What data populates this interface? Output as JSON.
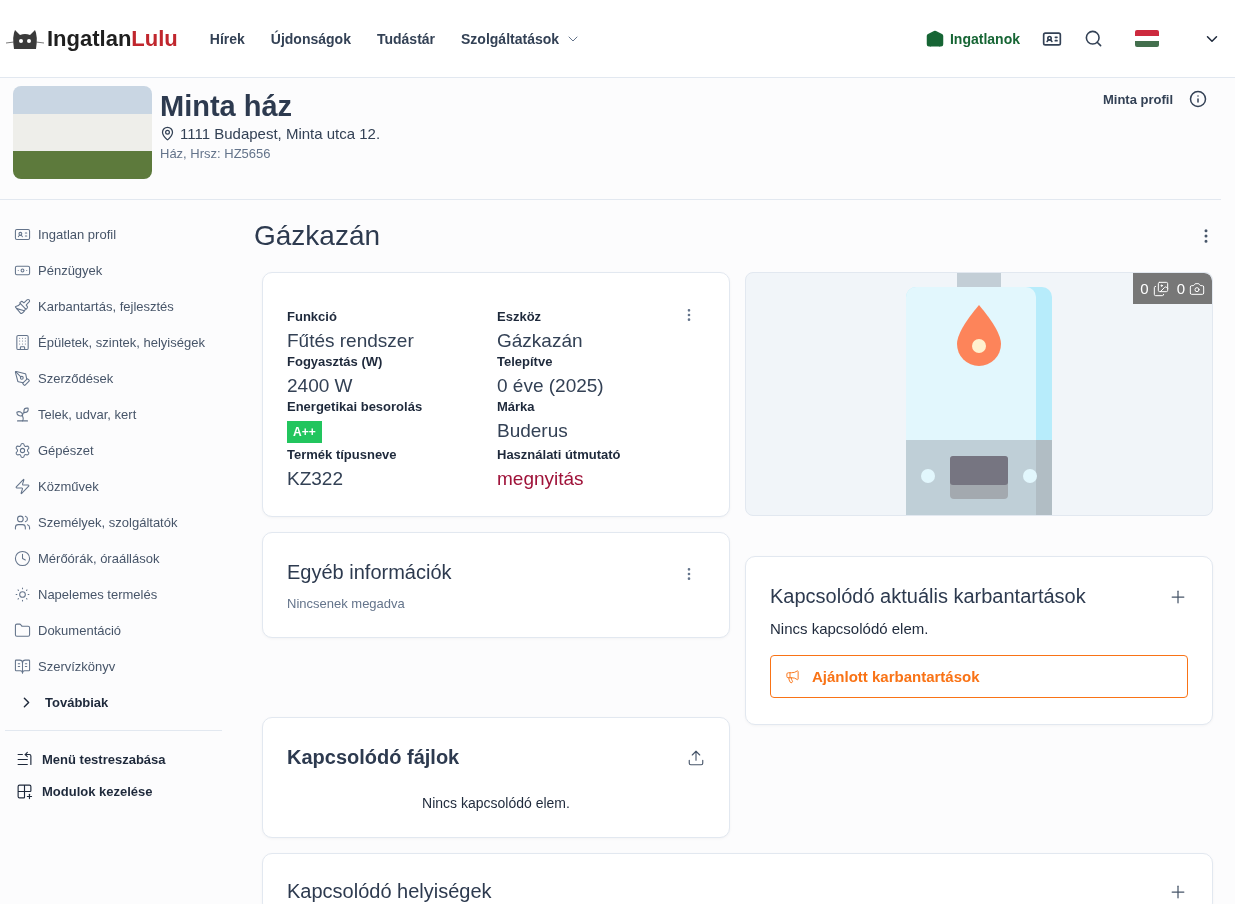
{
  "header": {
    "logo": {
      "first": "Ingatlan",
      "second": "Lulu"
    },
    "nav": [
      {
        "label": "Hírek",
        "dropdown": false
      },
      {
        "label": "Újdonságok",
        "dropdown": false
      },
      {
        "label": "Tudástár",
        "dropdown": false
      },
      {
        "label": "Szolgáltatások",
        "dropdown": true
      }
    ],
    "properties_link": "Ingatlanok"
  },
  "property": {
    "title": "Minta ház",
    "address": "1111 Budapest, Minta utca 12.",
    "subtitle": "Ház, Hrsz: HZ5656",
    "profile": "Minta profil"
  },
  "sidebar": {
    "items": [
      {
        "label": "Ingatlan profil"
      },
      {
        "label": "Pénzügyek"
      },
      {
        "label": "Karbantartás, fejlesztés"
      },
      {
        "label": "Épületek, szintek, helyiségek"
      },
      {
        "label": "Szerződések"
      },
      {
        "label": "Telek, udvar, kert"
      },
      {
        "label": "Gépészet"
      },
      {
        "label": "Közművek"
      },
      {
        "label": "Személyek, szolgáltatók"
      },
      {
        "label": "Mérőórák, óraállások"
      },
      {
        "label": "Napelemes termelés"
      },
      {
        "label": "Dokumentáció"
      },
      {
        "label": "Szervízkönyv"
      }
    ],
    "more": "Továbbiak",
    "actions": [
      {
        "label": "Menü testreszabása"
      },
      {
        "label": "Modulok kezelése"
      }
    ]
  },
  "page_title": "Gázkazán",
  "details": {
    "fields": [
      {
        "label": "Funkció",
        "value": "Fűtés rendszer",
        "kind": "text"
      },
      {
        "label": "Eszköz",
        "value": "Gázkazán",
        "kind": "text"
      },
      {
        "label": "Fogyasztás (W)",
        "value": "2400 W",
        "kind": "text"
      },
      {
        "label": "Telepítve",
        "value": "0 éve (2025)",
        "kind": "text"
      },
      {
        "label": "Energetikai besorolás",
        "value": "A++",
        "kind": "badge"
      },
      {
        "label": "Márka",
        "value": "Buderus",
        "kind": "text"
      },
      {
        "label": "Termék típusneve",
        "value": "KZ322",
        "kind": "text"
      },
      {
        "label": "Használati útmutató",
        "value": "megnyitás",
        "kind": "link"
      }
    ]
  },
  "media": {
    "counters": [
      {
        "count": "0",
        "kind": "image"
      },
      {
        "count": "0",
        "kind": "photo"
      }
    ]
  },
  "other_info": {
    "title": "Egyéb információk",
    "empty_text": "Nincsenek megadva"
  },
  "maintenance": {
    "title": "Kapcsolódó aktuális karbantartások",
    "empty_text": "Nincs kapcsolódó elem.",
    "button": "Ajánlott karbantartások"
  },
  "files": {
    "title": "Kapcsolódó fájlok",
    "empty_text": "Nincs kapcsolódó elem."
  },
  "rooms": {
    "title": "Kapcsolódó helyiségek"
  }
}
